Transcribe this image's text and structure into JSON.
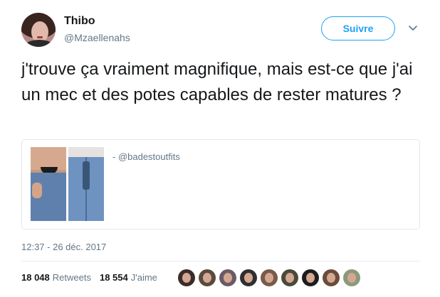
{
  "author": {
    "name": "Thibo",
    "handle": "@Mzaellenahs"
  },
  "follow_label": "Suivre",
  "tweet_text": "j'trouve ça vraiment magnifique, mais est-ce que j'ai un mec et des potes capables de rester matures ?",
  "embedded": {
    "credit": "- @badestoutfits"
  },
  "timestamp": "12:37 - 26 déc. 2017",
  "stats": {
    "retweets_count": "18 048",
    "retweets_label": "Retweets",
    "likes_count": "18 554",
    "likes_label": "J'aime"
  },
  "likers": [
    {
      "color": "#3b2b2b"
    },
    {
      "color": "#5a4a3e"
    },
    {
      "color": "#6b5a66"
    },
    {
      "color": "#2f2f2f"
    },
    {
      "color": "#7a5a48"
    },
    {
      "color": "#4a4a3a"
    },
    {
      "color": "#1d1d1d"
    },
    {
      "color": "#6b4b3b"
    },
    {
      "color": "#8a9a7a"
    }
  ],
  "colors": {
    "accent": "#1da1f2",
    "secondary_text": "#657786",
    "primary_text": "#14171a"
  }
}
